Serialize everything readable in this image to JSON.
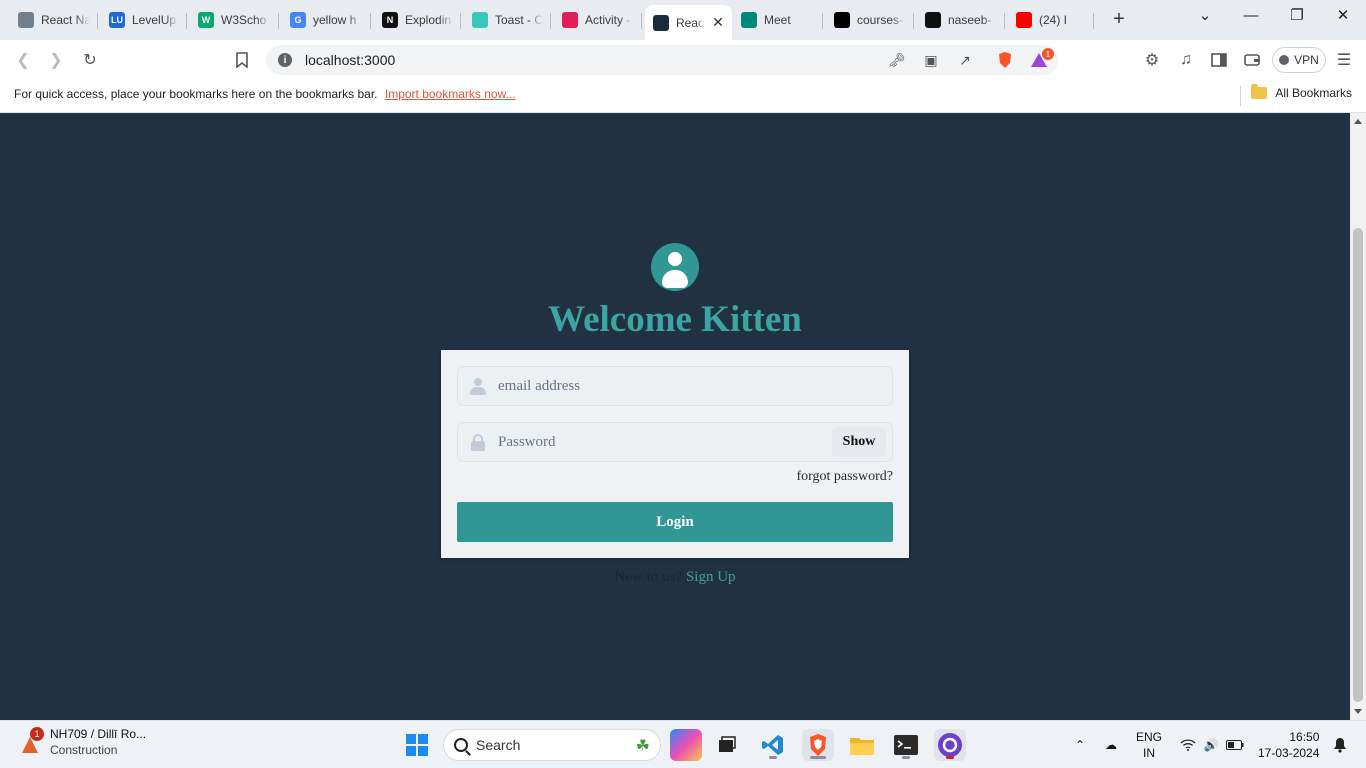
{
  "browser": {
    "tabs": [
      {
        "title": "React Na",
        "icon": "react-native-icon",
        "color": "#6e7f8d"
      },
      {
        "title": "LevelUp",
        "icon": "levelup-icon",
        "color": "#1e6bd8",
        "glyph": "LU"
      },
      {
        "title": "W3Scho",
        "icon": "w3schools-icon",
        "color": "#04aa6d",
        "glyph": "W"
      },
      {
        "title": "yellow h",
        "icon": "google-icon",
        "color": "#4285f4",
        "glyph": "G"
      },
      {
        "title": "Explodin",
        "icon": "notion-icon",
        "color": "#111111",
        "glyph": "N"
      },
      {
        "title": "Toast - C",
        "icon": "chakra-icon",
        "color": "#3cc7bd"
      },
      {
        "title": "Activity -",
        "icon": "slack-icon",
        "color": "#e01e5a"
      },
      {
        "title": "Reac",
        "icon": "react-icon",
        "color": "#1a2b3b",
        "active": true
      },
      {
        "title": "Meet",
        "icon": "google-meet-icon",
        "color": "#00897b"
      },
      {
        "title": "courses-",
        "icon": "vercel-icon",
        "color": "#000000"
      },
      {
        "title": "naseeb-",
        "icon": "github-icon",
        "color": "#111111"
      },
      {
        "title": "(24) I",
        "icon": "youtube-icon",
        "color": "#ff0000"
      }
    ],
    "new_tab": "+",
    "url": "localhost:3000",
    "vpn_label": "VPN",
    "rewards_badge": "1",
    "bookmarks_hint": "For quick access, place your bookmarks here on the bookmarks bar.",
    "import_link": "Import bookmarks now...",
    "all_bookmarks": "All Bookmarks"
  },
  "page": {
    "heading": "Welcome Kitten",
    "email_placeholder": "email address",
    "password_placeholder": "Password",
    "show_label": "Show",
    "forgot_label": "forgot password?",
    "login_label": "Login",
    "new_to_us": "New to us?",
    "signup_label": "Sign Up",
    "colors": {
      "background": "#213142",
      "accent": "#319795",
      "card": "#f0f1f2"
    }
  },
  "taskbar": {
    "weather_title": "NH709 / Dillī Ro...",
    "weather_sub": "Construction",
    "weather_badge": "1",
    "search_placeholder": "Search",
    "language_line1": "ENG",
    "language_line2": "IN",
    "time": "16:50",
    "date": "17-03-2024"
  }
}
